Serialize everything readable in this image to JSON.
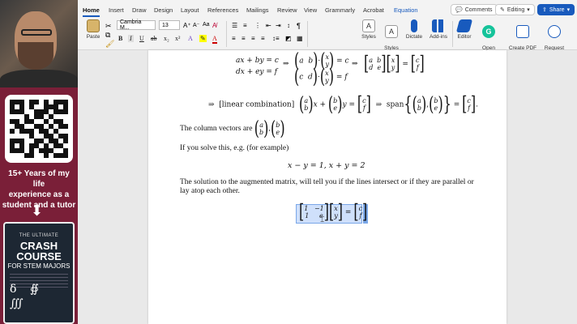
{
  "promo": {
    "lines": [
      "15+ Years of my life",
      "experience as a",
      "student and a tutor"
    ],
    "arrow": "⬇",
    "book_top": "THE ULTIMATE",
    "book_title_1": "CRASH COURSE",
    "book_title_2": "FOR STEM MAJORS",
    "book_symbols": [
      "δ",
      "∯",
      "∭"
    ]
  },
  "ribbon": {
    "tabs": [
      "Home",
      "Insert",
      "Draw",
      "Design",
      "Layout",
      "References",
      "Mailings",
      "Review",
      "View",
      "Grammarly",
      "Acrobat",
      "Equation"
    ],
    "active_tab": "Home",
    "comments_label": "Comments",
    "editing_label": "Editing",
    "share_label": "Share",
    "paste_label": "Paste",
    "font_name": "Cambria M...",
    "font_size": "13",
    "buttons": {
      "styles": "Styles",
      "styles_pane": "Styles\nPane",
      "dictate": "Dictate",
      "addins": "Add-ins",
      "editor": "Editor",
      "grammarly": "Open\nGrammarly",
      "pdf": "Create PDF\nand share link",
      "signatures": "Request\nSignatures"
    }
  },
  "document": {
    "eq1_line1": "ax + by = c",
    "eq1_line2": "dx + ey = f",
    "eq2_text": "[linear combination]",
    "para1": "The column vectors are",
    "para2": "If you solve this, e.g. (for example)",
    "eq3": "x − y = 1,      x + y = 2",
    "para3": "The solution to the augmented matrix, will tell you if the lines intersect or if they are parallel or lay atop each other."
  },
  "colors": {
    "accent": "#185abd",
    "sidebar": "#7a1f38",
    "selection": "#cfe0fb"
  }
}
